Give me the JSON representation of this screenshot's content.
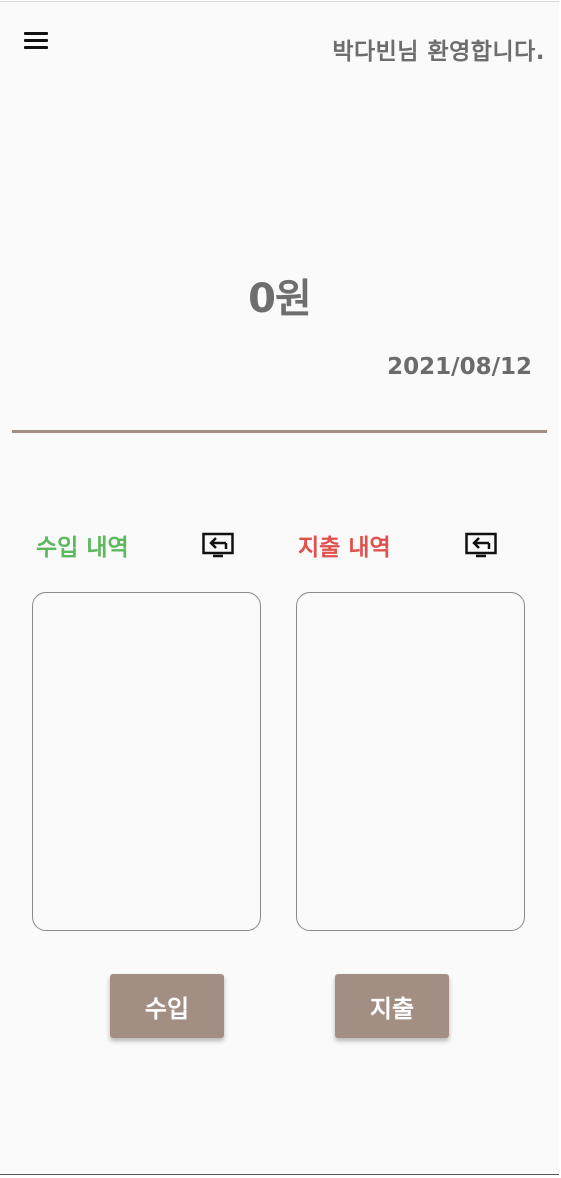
{
  "header": {
    "menu_icon": "hamburger-menu-icon",
    "welcome": "박다빈님 환영합니다."
  },
  "summary": {
    "balance": "0원",
    "date": "2021/08/12"
  },
  "income": {
    "title": "수입 내역",
    "icon": "swap-screen-icon",
    "button_label": "수입",
    "items": []
  },
  "expense": {
    "title": "지출 내역",
    "icon": "swap-screen-icon",
    "button_label": "지출",
    "items": []
  },
  "colors": {
    "accent": "#a38e83",
    "income_title": "#5cb85c",
    "expense_title": "#e0504c",
    "text_gray": "#6d6d6d",
    "background": "#fafafa"
  }
}
